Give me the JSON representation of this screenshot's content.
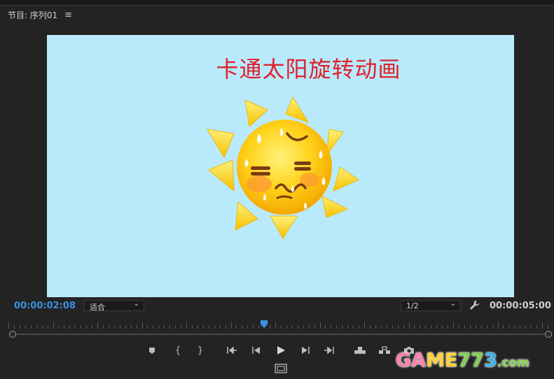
{
  "panel": {
    "title": "节目: 序列01",
    "menu_glyph": "≡"
  },
  "viewer": {
    "title": "卡通太阳旋转动画"
  },
  "timecode": {
    "current": "00:00:02:08",
    "duration": "00:00:05:00"
  },
  "zoom": {
    "selected": "适合"
  },
  "resolution": {
    "selected": "1/2"
  },
  "playhead": {
    "fraction": 0.474
  },
  "transport": [
    "add-marker",
    "mark-in",
    "mark-out",
    "go-to-in",
    "step-back",
    "play",
    "step-forward",
    "go-to-out",
    "lift",
    "extract",
    "export-frame"
  ],
  "colors": {
    "accent": "#3d8fe0",
    "background": "#232323",
    "viewer_bg": "#b8eafc",
    "title": "#e0212a"
  },
  "watermark": {
    "text": "GAME773",
    "suffix": ".com",
    "parts": [
      "GA",
      "ME",
      "77",
      "3"
    ]
  }
}
